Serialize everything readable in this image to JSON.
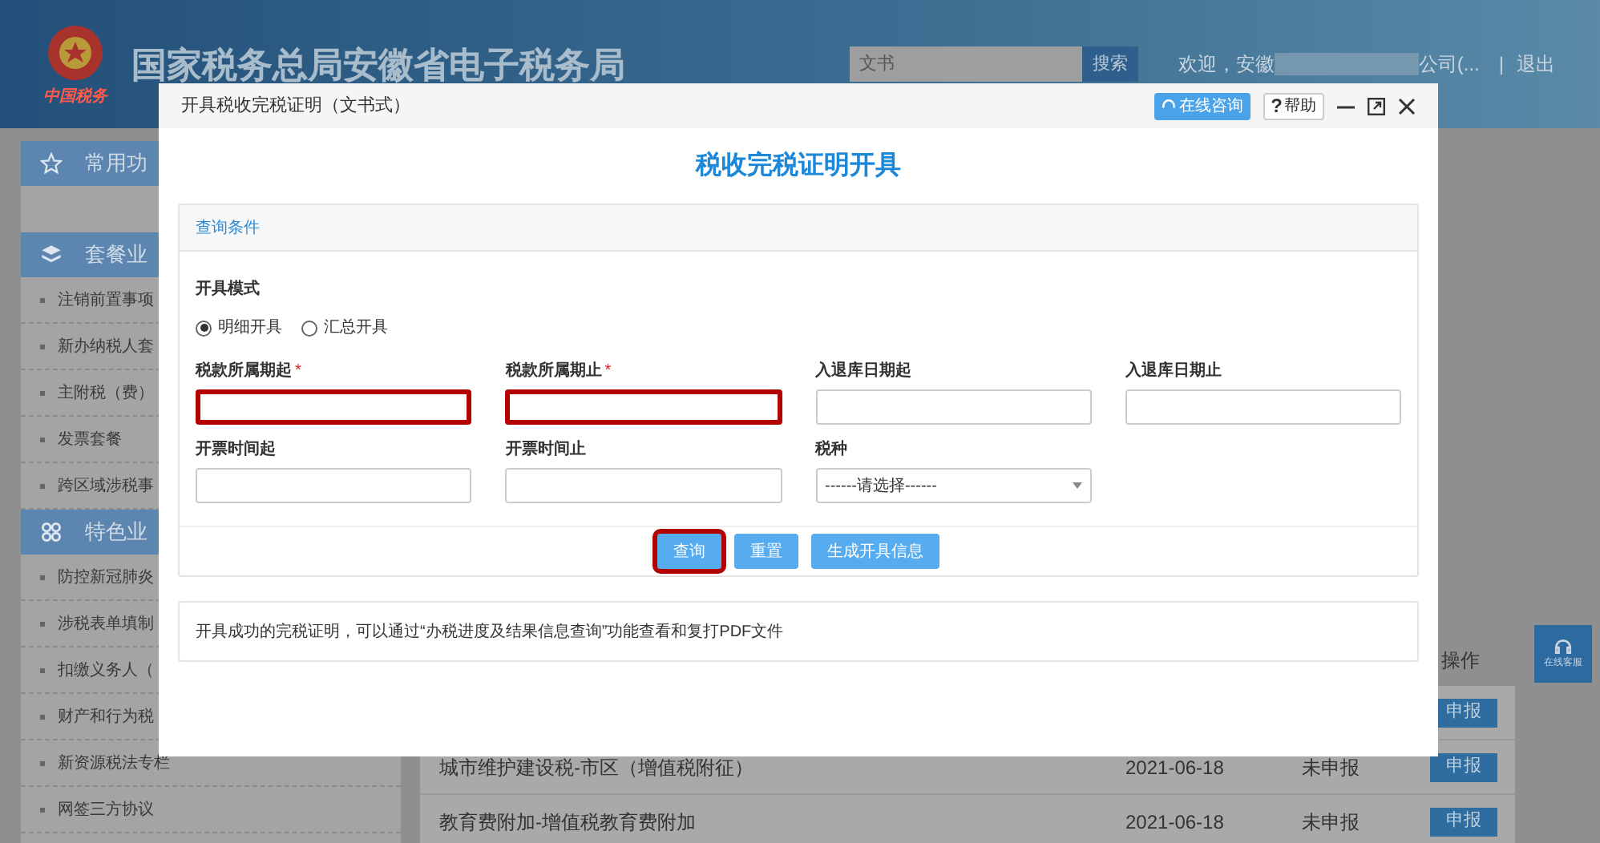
{
  "header": {
    "logo_text": "中国税务",
    "title": "国家税务总局安徽省电子税务局",
    "search": {
      "value": "文书",
      "button": "搜索"
    },
    "welcome": "欢迎，安徽",
    "company": "公司(...",
    "separator": "|",
    "logout": "退出"
  },
  "sidebar": {
    "sections": [
      {
        "kind": "star",
        "title": "常用功"
      },
      {
        "kind": "layers",
        "title": "套餐业",
        "items": [
          "注销前置事项",
          "新办纳税人套",
          "主附税（费）",
          "发票套餐",
          "跨区域涉税事"
        ]
      },
      {
        "kind": "clover",
        "title": "特色业",
        "items": [
          "防控新冠肺炎",
          "涉税表单填制",
          "扣缴义务人（",
          "财产和行为税",
          "新资源税法专栏",
          "网签三方协议"
        ]
      }
    ]
  },
  "table": {
    "header": {
      "column_5": "操作"
    },
    "rows": [
      {
        "name": "",
        "date": "",
        "status": "",
        "action": "申报"
      },
      {
        "name": "城市维护建设税-市区（增值税附征）",
        "date": "2021-06-18",
        "status": "未申报",
        "action": "申报"
      },
      {
        "name": "教育费附加-增值税教育费附加",
        "date": "2021-06-18",
        "status": "未申报",
        "action": "申报"
      }
    ]
  },
  "float_button": "在线客服",
  "dialog": {
    "title": "开具税收完税证明（文书式）",
    "consult_button": "在线咨询",
    "help_mark": "?",
    "help_button": "帮助",
    "heading": "税收完税证明开具",
    "panel_title": "查询条件",
    "mode_label": "开具模式",
    "modes": [
      {
        "label": "明细开具",
        "selected": true
      },
      {
        "label": "汇总开具",
        "selected": false
      }
    ],
    "fields": [
      {
        "kind": "input",
        "label": "税款所属期起",
        "required": true,
        "highlighted": true
      },
      {
        "kind": "input",
        "label": "税款所属期止",
        "required": true,
        "highlighted": true
      },
      {
        "kind": "input",
        "label": "入退库日期起",
        "required": false,
        "highlighted": false
      },
      {
        "kind": "input",
        "label": "入退库日期止",
        "required": false,
        "highlighted": false
      },
      {
        "kind": "input",
        "label": "开票时间起",
        "required": false,
        "highlighted": false
      },
      {
        "kind": "input",
        "label": "开票时间止",
        "required": false,
        "highlighted": false
      },
      {
        "kind": "select",
        "label": "税种",
        "value": "------请选择------",
        "required": false,
        "highlighted": false
      }
    ],
    "required_mark": "*",
    "buttons": [
      {
        "label": "查询",
        "highlighted": true
      },
      {
        "label": "重置",
        "highlighted": false
      },
      {
        "label": "生成开具信息",
        "highlighted": false
      }
    ],
    "note": "开具成功的完税证明，可以通过“办税进度及结果信息查询”功能查看和复打PDF文件"
  }
}
